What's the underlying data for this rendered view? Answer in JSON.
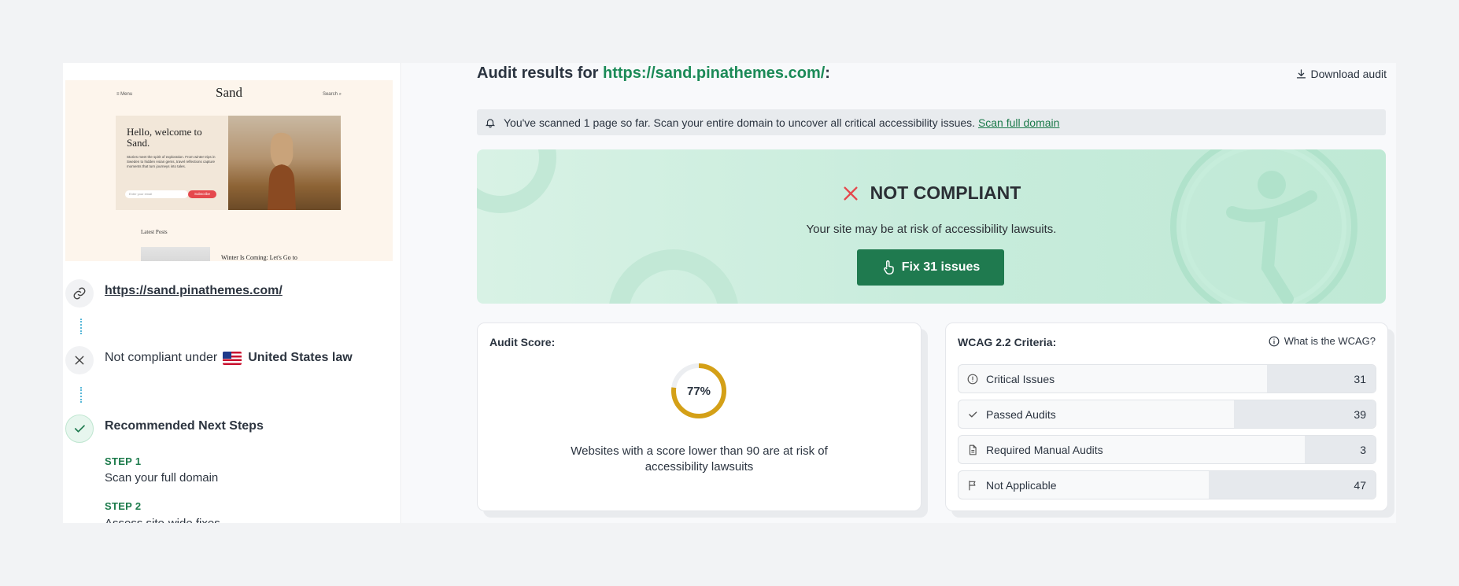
{
  "left": {
    "preview": {
      "menu": "≡ Menu",
      "logo": "Sand",
      "search": "Search",
      "hello": "Hello, welcome to Sand.",
      "description": "Stories meet the spirit of exploration. From winter trips in Sweden to hidden Asian gems, travel reflections capture moments that turn journeys into tales.",
      "email_placeholder": "Enter your email",
      "subscribe": "Subscribe",
      "latest": "Latest Posts",
      "post_title": "Winter Is Coming: Let's Go to"
    },
    "url": "https://sand.pinathemes.com/",
    "compliance": {
      "prefix": "Not compliant under",
      "law": "United States law"
    },
    "next_steps": {
      "title": "Recommended Next Steps",
      "steps": [
        {
          "label": "STEP 1",
          "text": "Scan your full domain"
        },
        {
          "label": "STEP 2",
          "text": "Assess site-wide fixes"
        }
      ]
    }
  },
  "header": {
    "title_prefix": "Audit results for",
    "url": "https://sand.pinathemes.com/",
    "title_suffix": ":",
    "download": "Download audit"
  },
  "notice": {
    "text": "You've scanned 1 page so far. Scan your entire domain to uncover all critical accessibility issues.",
    "link": "Scan full domain"
  },
  "banner": {
    "status": "NOT COMPLIANT",
    "subtitle": "Your site may be at risk of accessibility lawsuits.",
    "button": "Fix 31 issues"
  },
  "score_card": {
    "title": "Audit Score:",
    "score_value": 77,
    "score": "77%",
    "description": "Websites with a score lower than 90 are at risk of accessibility lawsuits",
    "ring_color": "#d4a017"
  },
  "wcag_card": {
    "title": "WCAG 2.2 Criteria:",
    "link": "What is the WCAG?",
    "criteria": [
      {
        "label": "Critical Issues",
        "count": "31",
        "icon": "alert-circle-icon",
        "fill": 0.26
      },
      {
        "label": "Passed Audits",
        "count": "39",
        "icon": "check-icon",
        "fill": 0.34
      },
      {
        "label": "Required Manual Audits",
        "count": "3",
        "icon": "document-icon",
        "fill": 0.17
      },
      {
        "label": "Not Applicable",
        "count": "47",
        "icon": "flag-icon",
        "fill": 0.4
      }
    ]
  },
  "colors": {
    "accent_green": "#1f7a4f",
    "link_green": "#1b8a57",
    "error_red": "#e5484d"
  }
}
